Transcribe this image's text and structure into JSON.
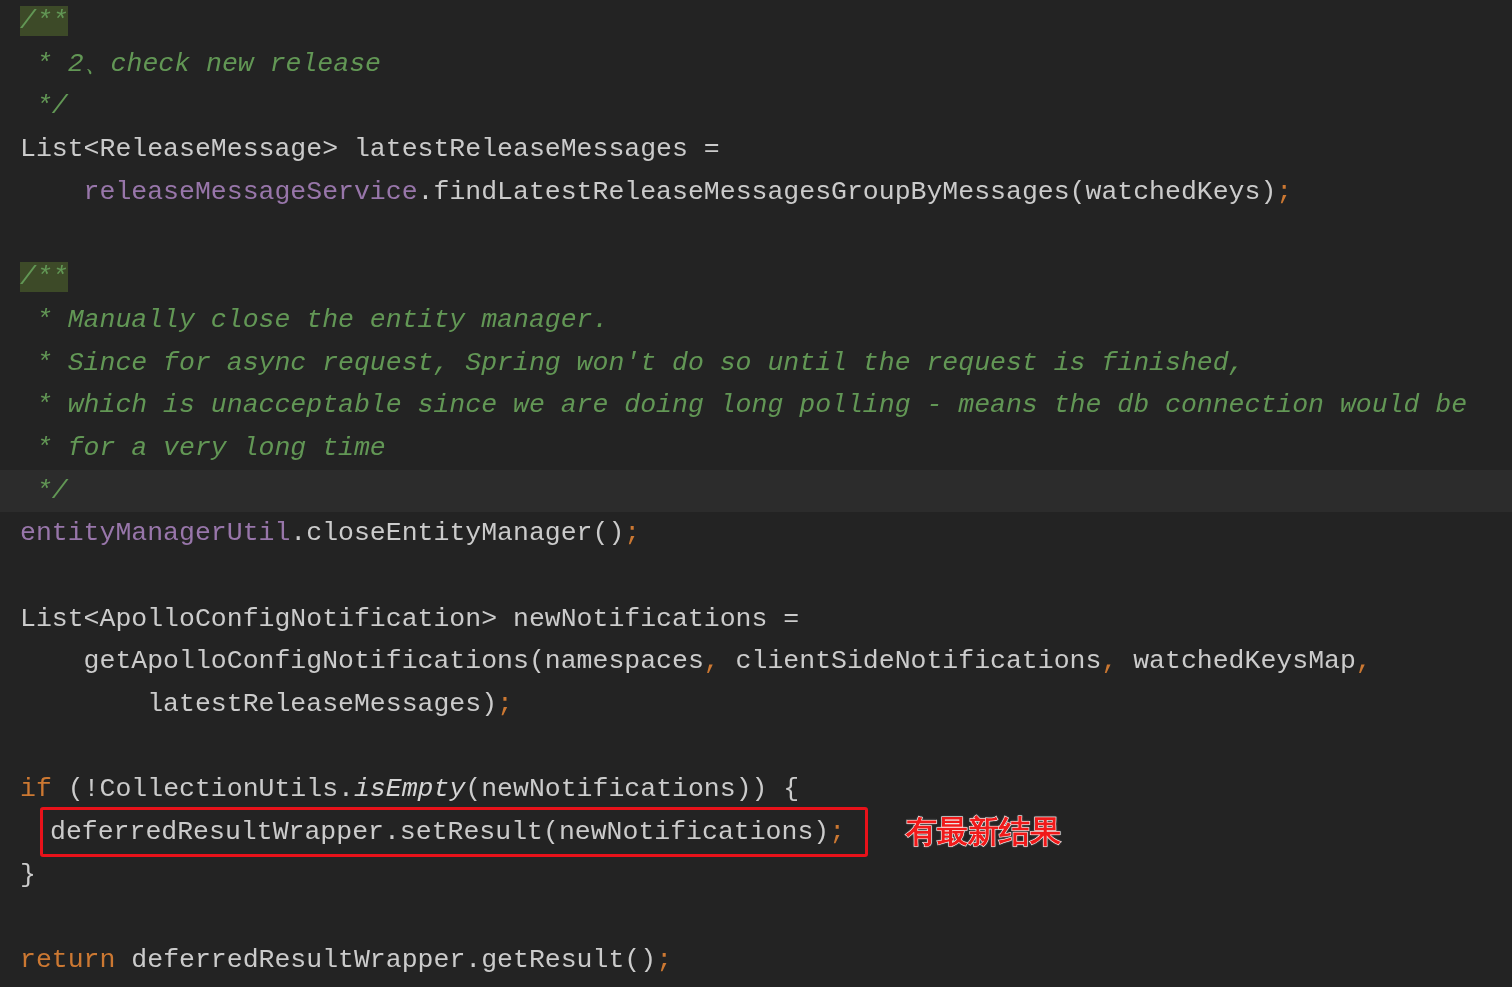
{
  "editor": {
    "lines": [
      {
        "kind": "code",
        "tokens": [
          {
            "text": "/**",
            "kind": "comment",
            "marked": true
          }
        ]
      },
      {
        "kind": "code",
        "tokens": [
          {
            "text": " * 2、check new release",
            "kind": "comment"
          }
        ]
      },
      {
        "kind": "code",
        "tokens": [
          {
            "text": " */",
            "kind": "comment"
          }
        ]
      },
      {
        "kind": "code",
        "tokens": [
          {
            "text": "List<ReleaseMessage> latestReleaseMessages =",
            "kind": "plain"
          }
        ]
      },
      {
        "kind": "code",
        "tokens": [
          {
            "text": "    releaseMessageService",
            "kind": "field"
          },
          {
            "text": ".findLatestReleaseMessagesGroupByMessages(watchedKeys)",
            "kind": "plain"
          },
          {
            "text": ";",
            "kind": "punct"
          }
        ]
      },
      {
        "kind": "blank"
      },
      {
        "kind": "code",
        "tokens": [
          {
            "text": "/**",
            "kind": "comment",
            "marked": true
          }
        ]
      },
      {
        "kind": "code",
        "tokens": [
          {
            "text": " * Manually close the entity manager.",
            "kind": "comment"
          }
        ]
      },
      {
        "kind": "code",
        "tokens": [
          {
            "text": " * Since for async request, Spring won't do so until the request is finished,",
            "kind": "comment"
          }
        ]
      },
      {
        "kind": "code",
        "tokens": [
          {
            "text": " * which is unacceptable since we are doing long polling - means the db connection would be",
            "kind": "comment"
          }
        ]
      },
      {
        "kind": "code",
        "tokens": [
          {
            "text": " * for a very long time",
            "kind": "comment"
          }
        ]
      },
      {
        "kind": "current",
        "tokens": [
          {
            "text": " */",
            "kind": "comment"
          }
        ]
      },
      {
        "kind": "code",
        "tokens": [
          {
            "text": "entityManagerUtil",
            "kind": "field"
          },
          {
            "text": ".closeEntityManager()",
            "kind": "plain"
          },
          {
            "text": ";",
            "kind": "punct"
          }
        ]
      },
      {
        "kind": "blank"
      },
      {
        "kind": "code",
        "tokens": [
          {
            "text": "List<ApolloConfigNotification> newNotifications =",
            "kind": "plain"
          }
        ]
      },
      {
        "kind": "code",
        "tokens": [
          {
            "text": "    getApolloConfigNotifications(namespaces",
            "kind": "plain"
          },
          {
            "text": ",",
            "kind": "punct"
          },
          {
            "text": " clientSideNotifications",
            "kind": "plain"
          },
          {
            "text": ",",
            "kind": "punct"
          },
          {
            "text": " watchedKeysMap",
            "kind": "plain"
          },
          {
            "text": ",",
            "kind": "punct"
          }
        ]
      },
      {
        "kind": "code",
        "tokens": [
          {
            "text": "        latestReleaseMessages)",
            "kind": "plain"
          },
          {
            "text": ";",
            "kind": "punct"
          }
        ]
      },
      {
        "kind": "blank"
      },
      {
        "kind": "code",
        "tokens": [
          {
            "text": "if",
            "kind": "keyword"
          },
          {
            "text": " (!CollectionUtils.",
            "kind": "plain"
          },
          {
            "text": "isEmpty",
            "kind": "static"
          },
          {
            "text": "(newNotifications)) {",
            "kind": "plain"
          }
        ]
      },
      {
        "kind": "boxed",
        "tokens": [
          {
            "text": "deferredResultWrapper.setResult(newNotifications)",
            "kind": "plain"
          },
          {
            "text": ";",
            "kind": "punct"
          }
        ],
        "annotation": "有最新结果"
      },
      {
        "kind": "code",
        "tokens": [
          {
            "text": "}",
            "kind": "plain"
          }
        ]
      },
      {
        "kind": "blank"
      },
      {
        "kind": "code",
        "tokens": [
          {
            "text": "return",
            "kind": "keyword"
          },
          {
            "text": " deferredResultWrapper.getResult()",
            "kind": "plain"
          },
          {
            "text": ";",
            "kind": "punct"
          }
        ]
      }
    ]
  }
}
